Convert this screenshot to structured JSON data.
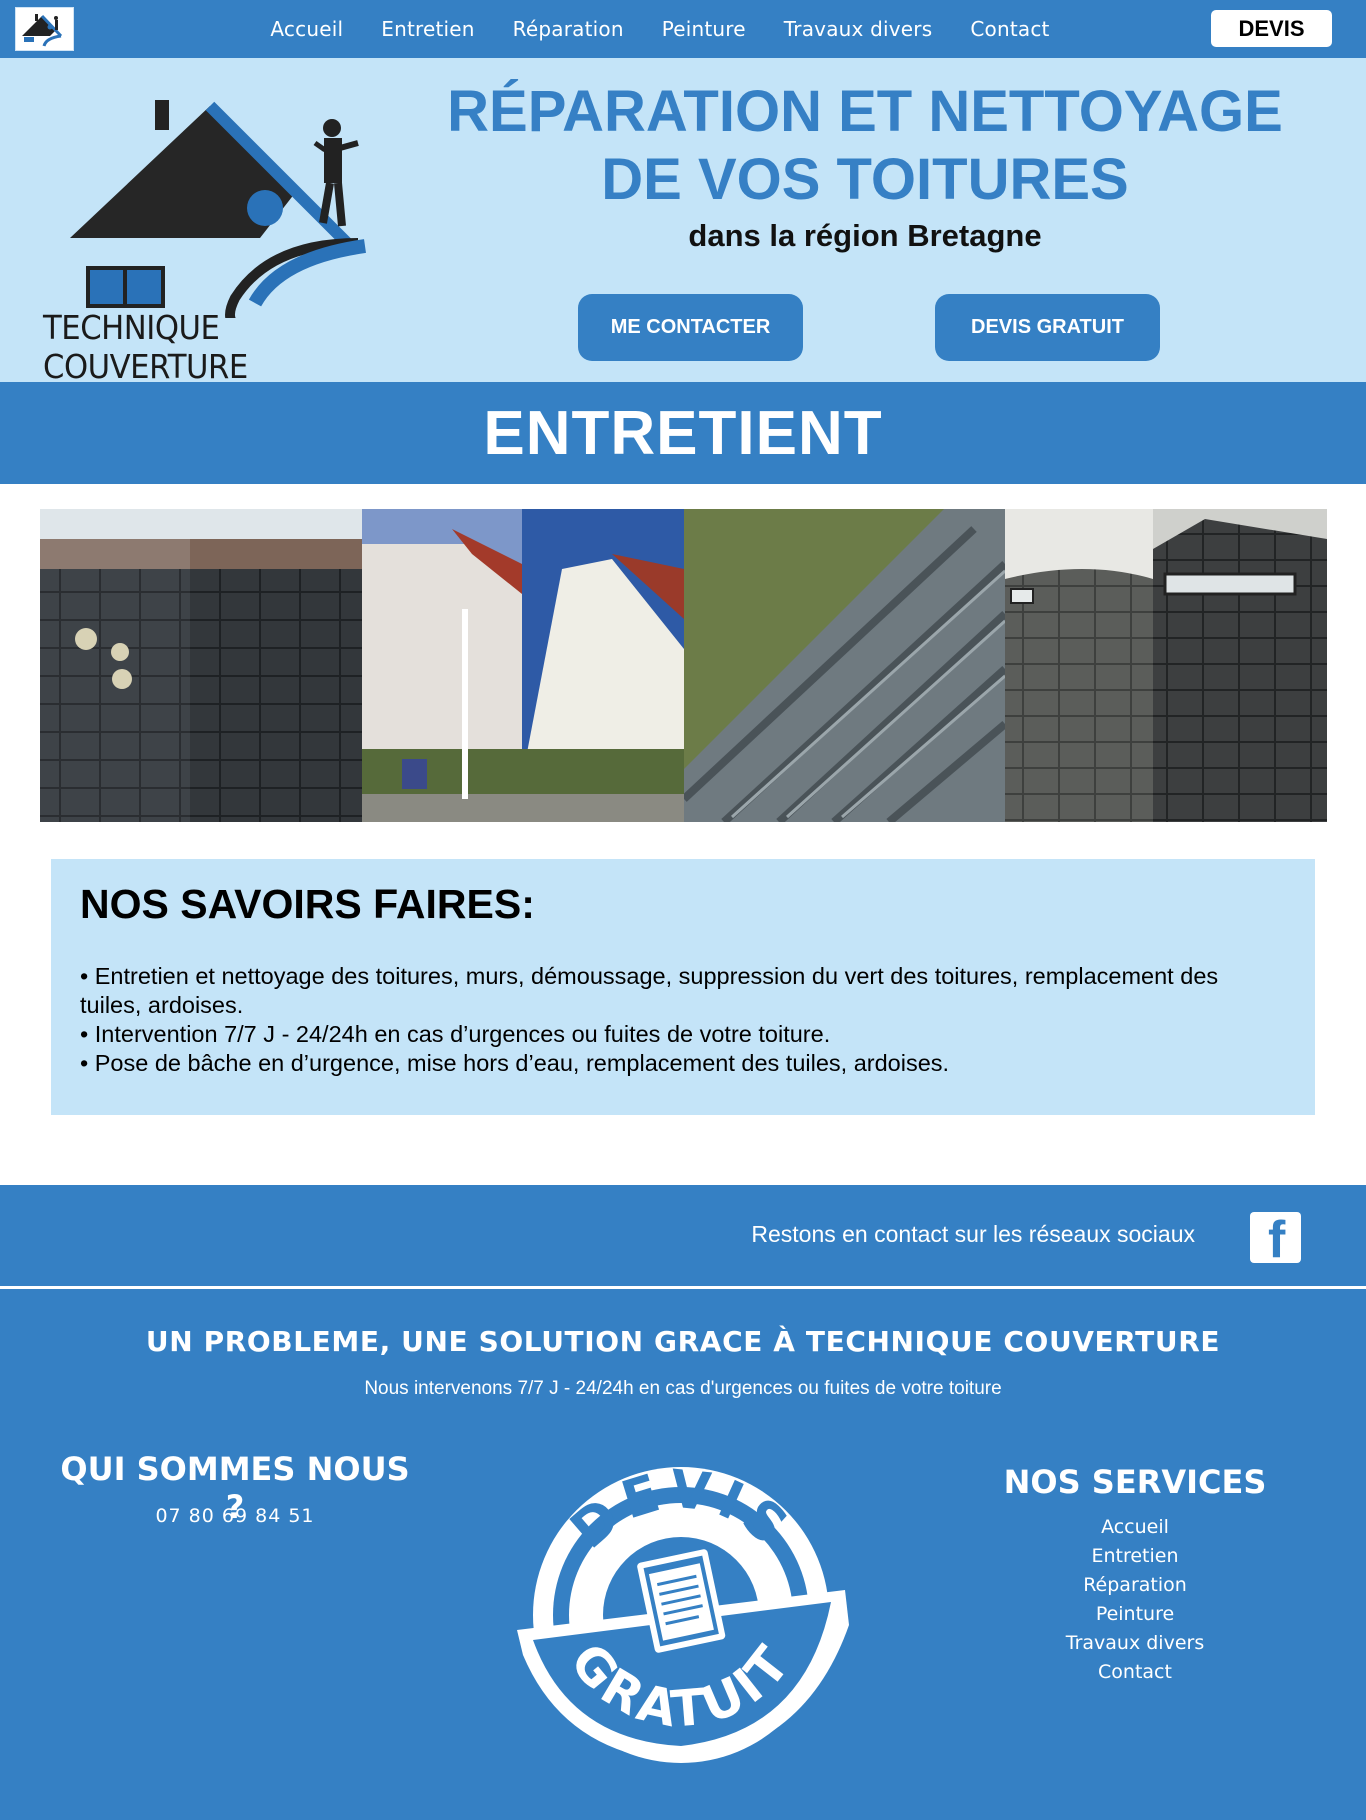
{
  "nav": {
    "logo_icon": "house-roofer-logo",
    "links": [
      "Accueil",
      "Entretien",
      "Réparation",
      "Peinture",
      "Travaux divers",
      "Contact"
    ],
    "devis_label": "DEVIS"
  },
  "hero": {
    "logo_text": "TECHNIQUE COUVERTURE",
    "title_line1": "RÉPARATION ET NETTOYAGE",
    "title_line2": "DE VOS TOITURES",
    "subtitle": "dans la région Bretagne",
    "contact_button": "ME CONTACTER",
    "devis_button": "DEVIS GRATUIT"
  },
  "section": {
    "title": "ENTRETIENT"
  },
  "gallery": {
    "images": [
      "slate-roof-before-after",
      "wall-cleaning-before-after",
      "moss-tile-roof",
      "slate-roof-cleaning"
    ]
  },
  "savoirs": {
    "title": "NOS SAVOIRS FAIRES:",
    "lines": [
      "• Entretien et nettoyage des toitures, murs, démoussage, suppression du vert des toitures, remplacement des tuiles, ardoises.",
      "• Intervention 7/7 J - 24/24h en cas d’urgences ou fuites de votre toiture.",
      "• Pose de bâche en d’urgence, mise hors d’eau, remplacement des tuiles, ardoises."
    ]
  },
  "footer": {
    "social_text": "Restons en contact sur les réseaux sociaux",
    "social_icon": "facebook-icon",
    "headline": "UN PROBLEME, UNE SOLUTION GRACE À TECHNIQUE COUVERTURE",
    "subline": "Nous intervenons 7/7 J - 24/24h en cas d'urgences ou fuites de votre toiture",
    "qui_title": "QUI SOMMES NOUS ?",
    "phone": "07 80 69 84 51",
    "stamp_top": "DEVIS",
    "stamp_bottom": "GRATUIT",
    "services_title": "NOS SERVICES",
    "services": [
      "Accueil",
      "Entretien",
      "Réparation",
      "Peinture",
      "Travaux divers",
      "Contact"
    ]
  },
  "colors": {
    "brand_blue": "#3580c4",
    "light_blue": "#c4e4f8",
    "white": "#ffffff"
  }
}
